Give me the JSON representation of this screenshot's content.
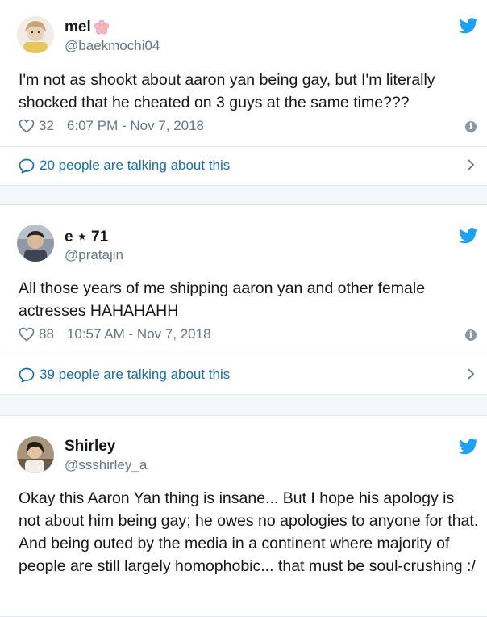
{
  "tweets": [
    {
      "name": "mel",
      "handle": "@baekmochi04",
      "text": "I'm not as shookt about aaron yan being gay, but I'm literally shocked that he cheated on 3 guys at the same time???",
      "likes": "32",
      "timestamp": "6:07 PM - Nov 7, 2018",
      "talking": "20 people are talking about this"
    },
    {
      "name": "e ⋆ 71",
      "handle": "@pratajin",
      "text": "All those years of me shipping aaron yan and other female actresses HAHAHAHH",
      "likes": "88",
      "timestamp": "10:57 AM - Nov 7, 2018",
      "talking": "39 people are talking about this"
    },
    {
      "name": "Shirley",
      "handle": "@ssshirley_a",
      "text": "Okay this Aaron Yan thing is insane... But I hope his apology is not about him being gay; he owes no apologies to anyone for that. And being outed by the media in a continent where majority of people are still largely homophobic... that must be soul-crushing :/"
    }
  ],
  "icons": {
    "brand": "twitter-bird-icon",
    "like": "heart-icon",
    "info": "info-icon",
    "reply": "speech-bubble-icon",
    "more": "chevron-right-icon",
    "name_decoration": "cherry-blossom-icon"
  },
  "colors": {
    "twitter_blue": "#1da1f2",
    "link_blue": "#1b6fa8",
    "secondary_text": "#657786",
    "divider": "#e1e8ed",
    "page_bg": "#f5f8fa"
  }
}
